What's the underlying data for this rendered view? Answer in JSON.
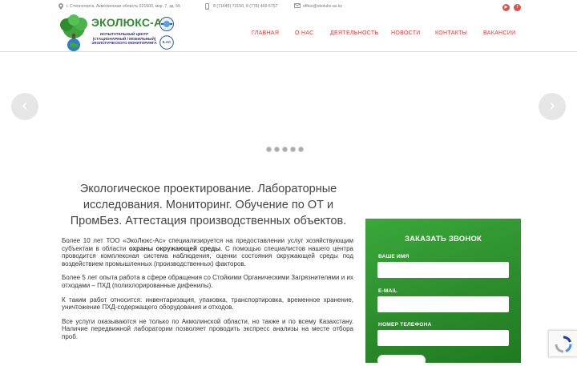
{
  "topbar": {
    "address": "г. Степногорск, Акмолинская область 021500, мкр. 7, зд. 55",
    "phone": "8 (71645) 73150, 8 (778) 469 6757",
    "email": "office@ekoluks-as.kz",
    "social": [
      "youtube-icon",
      "facebook-icon"
    ]
  },
  "logo": {
    "title": "ЭКОЛЮКС-АС",
    "subtitle_line1": "ИСПЫТАТЕЛЬНЫЙ ЦЕНТР",
    "subtitle_line2": "(СТАЦИОНАРНЫЙ / МОБИЛЬНЫЙ)",
    "subtitle_line3": "ЭКОЛОГИЧЕСКОГО МОНИТОРИНГА",
    "badge2_text": "ILAC"
  },
  "nav": {
    "items": [
      "ГЛАВНАЯ",
      "О НАС",
      "ДЕЯТЕЛЬНОСТЬ",
      "НОВОСТИ",
      "КОНТАКТЫ",
      "ВАКАНСИИ"
    ]
  },
  "slider": {
    "prev": "‹",
    "next": "›",
    "dots_count": 5
  },
  "headline": "Экологическое проектирование. Лабораторные исследования. Мониторинг. Обучение по ОТ и ПромБез. Аттестация производственных объектов.",
  "content": {
    "p1_a": "Более 10 лет ТОО «ЭкоЛюкс-Ас» специализируется на предоставлении услуг хозяйствующим субъектам в области ",
    "p1_bold": "охраны окружающей среды",
    "p1_b": ". С помощью специалистов нашего центра проводится комплексная система наблюдения, оценки состояния окружающей среды под воздействием промышленных (производственных) факторов.",
    "p2": "Более 5 лет опыта работа в сфере обращения со Стойкими Органическими Загрязнителями и их отходами – ПХД (полихлорированные дифенилы).",
    "p3": "К таким работ относится: инвентаризация, упаковка, транспортировка, временное хранение, уничтожение ПХД-содержащего оборудования и отходов.",
    "p4": "Все услуги оказываются не только по Акмолинской области, но также и по всему Казахстану. Наличие передвижной лаборатории позволяет проводить экспресс анализы на месте отбора проб."
  },
  "form": {
    "title": "ЗАКАЗАТЬ ЗВОНОК",
    "name_label": "ВАШЕ ИМЯ",
    "email_label": "E-MAIL",
    "phone_label": "НОМЕР ТЕЛЕФОНА"
  },
  "colors": {
    "brand_green": "#2e8b2e",
    "nav_red": "#e53935",
    "form_green": "#2b8a2b"
  }
}
